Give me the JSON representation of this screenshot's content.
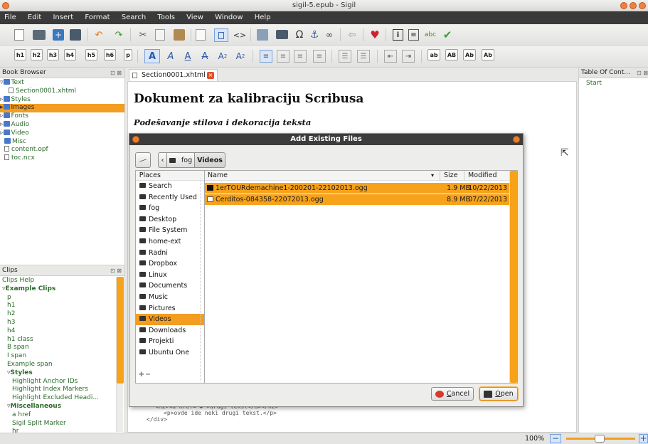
{
  "window": {
    "title": "sigil-5.epub - Sigil"
  },
  "menu": [
    "File",
    "Edit",
    "Insert",
    "Format",
    "Search",
    "Tools",
    "View",
    "Window",
    "Help"
  ],
  "heading_buttons": [
    "h1",
    "h2",
    "h3",
    "h4",
    "h5",
    "h6",
    "p"
  ],
  "case_buttons": [
    "ab",
    "AB",
    "Ab",
    "Ab"
  ],
  "book_browser": {
    "title": "Book Browser",
    "items": [
      {
        "label": "Text",
        "type": "folder",
        "indent": 0
      },
      {
        "label": "Section0001.xhtml",
        "type": "file",
        "indent": 2
      },
      {
        "label": "Styles",
        "type": "folder",
        "indent": 0
      },
      {
        "label": "Images",
        "type": "folder",
        "indent": 0,
        "selected": true
      },
      {
        "label": "Fonts",
        "type": "folder",
        "indent": 0
      },
      {
        "label": "Audio",
        "type": "folder",
        "indent": 0
      },
      {
        "label": "Video",
        "type": "folder",
        "indent": 0
      },
      {
        "label": "Misc",
        "type": "folder",
        "indent": 1
      },
      {
        "label": "content.opf",
        "type": "file",
        "indent": 1
      },
      {
        "label": "toc.ncx",
        "type": "file",
        "indent": 1
      }
    ]
  },
  "clips": {
    "title": "Clips",
    "items": [
      {
        "label": "Clips Help",
        "indent": 0,
        "bold": false
      },
      {
        "label": "Example Clips",
        "indent": 0,
        "bold": true
      },
      {
        "label": "p",
        "indent": 1,
        "bold": false
      },
      {
        "label": "h1",
        "indent": 1,
        "bold": false
      },
      {
        "label": "h2",
        "indent": 1,
        "bold": false
      },
      {
        "label": "h3",
        "indent": 1,
        "bold": false
      },
      {
        "label": "h4",
        "indent": 1,
        "bold": false
      },
      {
        "label": "h1 class",
        "indent": 1,
        "bold": false
      },
      {
        "label": "B span",
        "indent": 1,
        "bold": false
      },
      {
        "label": "I span",
        "indent": 1,
        "bold": false
      },
      {
        "label": "Example span",
        "indent": 1,
        "bold": false
      },
      {
        "label": "Styles",
        "indent": 1,
        "bold": true
      },
      {
        "label": "Highlight Anchor IDs",
        "indent": 2,
        "bold": false
      },
      {
        "label": "Highlight Index Markers",
        "indent": 2,
        "bold": false
      },
      {
        "label": "Highlight Excluded Headi...",
        "indent": 2,
        "bold": false
      },
      {
        "label": "Miscellaneous",
        "indent": 1,
        "bold": true
      },
      {
        "label": "a href",
        "indent": 2,
        "bold": false
      },
      {
        "label": "Sigil Split Marker",
        "indent": 2,
        "bold": false
      },
      {
        "label": "hr",
        "indent": 2,
        "bold": false
      }
    ]
  },
  "editor": {
    "tab_label": "Section0001.xhtml",
    "title": "Dokument za kalibraciju Scribusa",
    "subtitle": "Podešavanje stilova i dekoracija teksta",
    "code_lines": [
      "<h2><a href=\"#\">drugi tekst</a></h2>",
      "<p>ovde ide neki drugi tekst.</p>",
      "</div>"
    ]
  },
  "toc": {
    "title": "Table Of Cont...",
    "items": [
      "Start"
    ]
  },
  "dialog": {
    "title": "Add Existing Files",
    "path": [
      "fog",
      "Videos"
    ],
    "places_header": "Places",
    "places": [
      {
        "label": "Search",
        "selected": false
      },
      {
        "label": "Recently Used",
        "selected": false
      },
      {
        "label": "fog",
        "selected": false
      },
      {
        "label": "Desktop",
        "selected": false
      },
      {
        "label": "File System",
        "selected": false
      },
      {
        "label": "home-ext",
        "selected": false
      },
      {
        "label": "Radni",
        "selected": false
      },
      {
        "label": "Dropbox",
        "selected": false
      },
      {
        "label": "Linux",
        "selected": false
      },
      {
        "label": "Documents",
        "selected": false
      },
      {
        "label": "Music",
        "selected": false
      },
      {
        "label": "Pictures",
        "selected": false
      },
      {
        "label": "Videos",
        "selected": true
      },
      {
        "label": "Downloads",
        "selected": false
      },
      {
        "label": "Projekti",
        "selected": false
      },
      {
        "label": "Ubuntu One",
        "selected": false
      }
    ],
    "columns": {
      "name": "Name",
      "size": "Size",
      "modified": "Modified"
    },
    "files": [
      {
        "name": "1erTOURdemachine1-200201-22102013.ogg",
        "size": "1.9 MB",
        "modified": "10/22/2013"
      },
      {
        "name": "Cerditos-084358-22072013.ogg",
        "size": "8.9 MB",
        "modified": "07/22/2013"
      }
    ],
    "cancel_label": "Cancel",
    "open_label": "Open",
    "cancel_accel": "C",
    "open_accel": "O"
  },
  "status": {
    "zoom": "100%"
  },
  "colors": {
    "selection": "#f39d21",
    "menubar": "#3a3a3a",
    "tree_text": "#2a6a2a"
  }
}
